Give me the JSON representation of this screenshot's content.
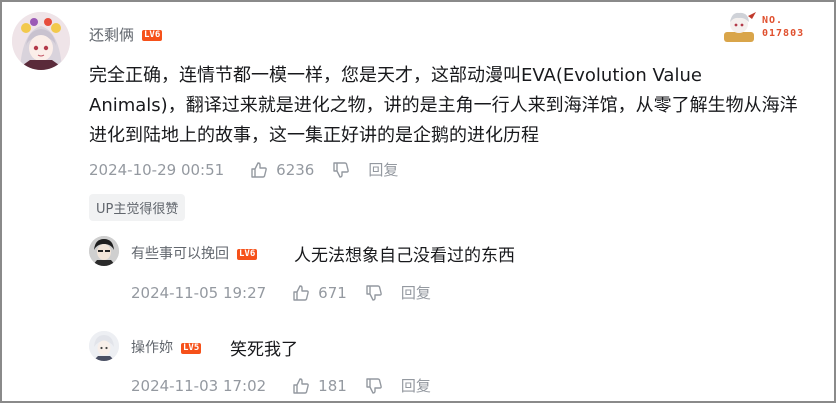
{
  "main_comment": {
    "username": "还剩俩",
    "level": "LV6",
    "content": "完全正确，连情节都一模一样，您是天才，这部动漫叫EVA(Evolution Value Animals)，翻译过来就是进化之物，讲的是主角一行人来到海洋馆，从零了解生物从海洋进化到陆地上的故事，这一集正好讲的是企鹅的进化历程",
    "timestamp": "2024-10-29 00:51",
    "likes": "6236",
    "reply_label": "回复",
    "up_badge": "UP主觉得很赞",
    "fan_badge": {
      "line1": "NO.",
      "line2": "017803"
    }
  },
  "replies": [
    {
      "username": "有些事可以挽回",
      "level": "LV6",
      "content": "人无法想象自己没看过的东西",
      "timestamp": "2024-11-05 19:27",
      "likes": "671",
      "reply_label": "回复"
    },
    {
      "username": "操作妳",
      "level": "LV5",
      "content": "笑死我了",
      "timestamp": "2024-11-03 17:02",
      "likes": "181",
      "reply_label": "回复"
    }
  ],
  "colors": {
    "level_badge": "#f6511a",
    "meta_text": "#9499a0",
    "username": "#61666d",
    "fan_number": "#e0502e"
  }
}
